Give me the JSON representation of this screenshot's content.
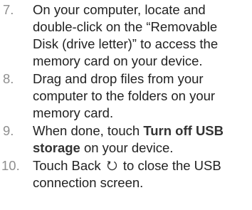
{
  "steps": [
    {
      "number": "7.",
      "text": "On your computer, locate and double-click on the “Removable Disk (drive letter)” to access the memory card on your device."
    },
    {
      "number": "8.",
      "text": "Drag and drop files from your computer to the folders on your memory card."
    },
    {
      "number": "9.",
      "text_before": "When done, touch ",
      "bold": "Turn off USB storage",
      "text_after": " on your device."
    },
    {
      "number": "10.",
      "text_before": "Touch Back ",
      "icon": "back-icon",
      "text_after": " to close the USB connection screen."
    }
  ],
  "colors": {
    "text": "#222222",
    "step_number": "#8f8f8f",
    "bold_term": "#333333"
  }
}
